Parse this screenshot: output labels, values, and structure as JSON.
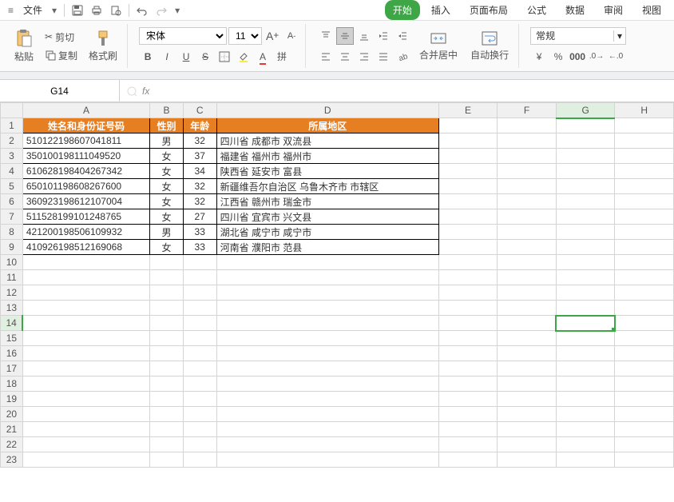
{
  "menubar": {
    "file": "文件",
    "tabs": [
      "开始",
      "插入",
      "页面布局",
      "公式",
      "数据",
      "审阅",
      "视图"
    ],
    "active_tab": 0
  },
  "ribbon": {
    "paste": "粘贴",
    "cut": "剪切",
    "copy": "复制",
    "format_painter": "格式刷",
    "font_name": "宋体",
    "font_size": "11",
    "merge_center": "合并居中",
    "wrap_text": "自动换行",
    "number_format": "常规"
  },
  "namebox": "G14",
  "columns": [
    "A",
    "B",
    "C",
    "D",
    "E",
    "F",
    "G",
    "H"
  ],
  "headers": {
    "A": "姓名和身份证号码",
    "B": "性别",
    "C": "年龄",
    "D": "所属地区"
  },
  "rows": [
    {
      "A": "510122198607041811",
      "B": "男",
      "C": "32",
      "D": "四川省  成都市  双流县"
    },
    {
      "A": "350100198111049520",
      "B": "女",
      "C": "37",
      "D": "福建省  福州市  福州市"
    },
    {
      "A": "610628198404267342",
      "B": "女",
      "C": "34",
      "D": "陕西省  延安市  富县"
    },
    {
      "A": "650101198608267600",
      "B": "女",
      "C": "32",
      "D": "新疆维吾尔自治区  乌鲁木齐市  市辖区"
    },
    {
      "A": "360923198612107004",
      "B": "女",
      "C": "32",
      "D": "江西省  赣州市  瑞金市"
    },
    {
      "A": "511528199101248765",
      "B": "女",
      "C": "27",
      "D": "四川省  宜宾市  兴文县"
    },
    {
      "A": "421200198506109932",
      "B": "男",
      "C": "33",
      "D": "湖北省  咸宁市  咸宁市"
    },
    {
      "A": "410926198512169068",
      "B": "女",
      "C": "33",
      "D": "河南省  濮阳市  范县"
    }
  ],
  "selected": {
    "col": "G",
    "row": 14
  },
  "col_widths": {
    "A": 160,
    "B": 42,
    "C": 42,
    "D": 280,
    "E": 75,
    "F": 75,
    "G": 75,
    "H": 75
  },
  "total_rows": 23
}
